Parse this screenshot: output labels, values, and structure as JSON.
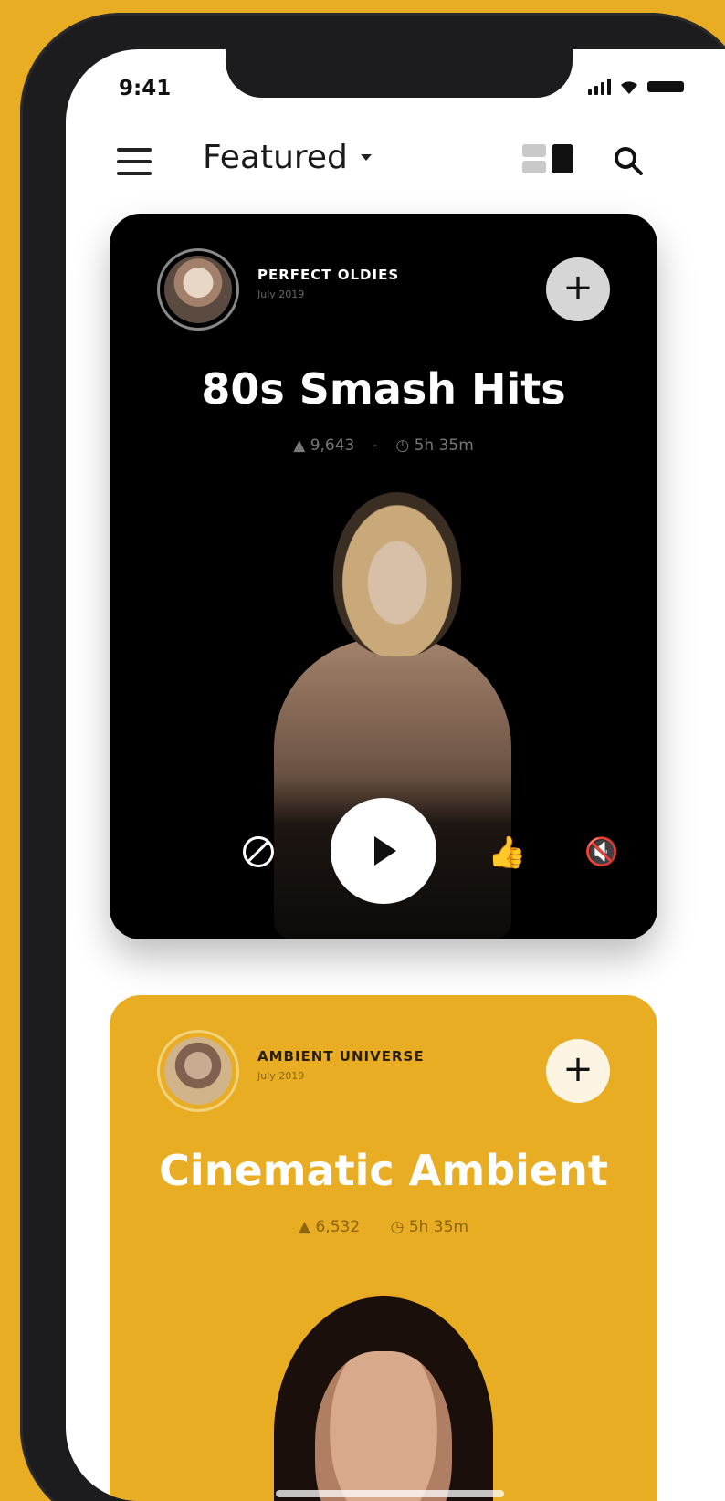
{
  "status_bar": {
    "time": "9:41"
  },
  "header": {
    "title": "Featured",
    "search_icon": "search-icon",
    "view_toggle_icon": "view-toggle-icon",
    "menu_icon": "hamburger-icon"
  },
  "cards": [
    {
      "channel": "PERFECT OLDIES",
      "date": "July 2019",
      "title": "80s Smash Hits",
      "likes": "9,643",
      "duration": "5h 35m",
      "background": "#000000",
      "add_label": "+"
    },
    {
      "channel": "AMBIENT UNIVERSE",
      "date": "July 2019",
      "title": "Cinematic Ambient",
      "likes": "6,532",
      "duration": "5h 35m",
      "background": "#e8ad23",
      "add_label": "+"
    }
  ],
  "player_controls": [
    "block-icon",
    "play-icon",
    "like-icon",
    "mute-icon"
  ],
  "colors": {
    "accent": "#e8ad23",
    "card_dark": "#000000"
  }
}
